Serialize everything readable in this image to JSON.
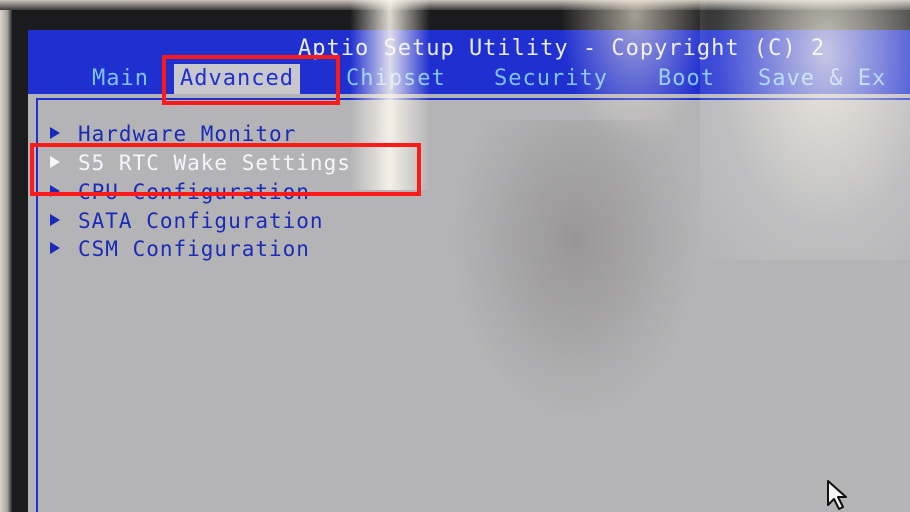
{
  "title": "Aptio Setup Utility - Copyright (C) 2",
  "tabs": [
    {
      "label": "Main",
      "active": false
    },
    {
      "label": "Advanced",
      "active": true
    },
    {
      "label": "Chipset",
      "active": false
    },
    {
      "label": "Security",
      "active": false
    },
    {
      "label": "Boot",
      "active": false
    },
    {
      "label": "Save & Ex",
      "active": false
    }
  ],
  "menu": [
    {
      "label": "Hardware Monitor",
      "selected": false
    },
    {
      "label": "S5 RTC Wake Settings",
      "selected": true
    },
    {
      "label": "CPU Configuration",
      "selected": false
    },
    {
      "label": "SATA Configuration",
      "selected": false
    },
    {
      "label": "CSM Configuration",
      "selected": false
    }
  ],
  "colors": {
    "bios_blue": "#1f2fd0",
    "background": "#b4b4b6",
    "highlight": "#ff1a1a",
    "selected_text": "#f4f5ff"
  },
  "icons": {
    "menu_arrow": "submenu-arrow-icon",
    "pointer": "mouse-pointer-icon"
  }
}
